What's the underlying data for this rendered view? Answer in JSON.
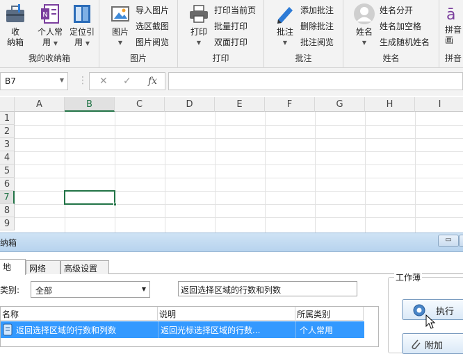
{
  "ribbon": {
    "groups": [
      {
        "label": "我的收纳箱",
        "big": [
          {
            "label1": "收",
            "label2": "纳箱"
          },
          {
            "label1": "个人常",
            "label2": "用"
          },
          {
            "label1": "定位引",
            "label2": "用"
          }
        ]
      },
      {
        "label": "图片",
        "big": [
          {
            "label1": "图片"
          }
        ],
        "small": [
          "导入图片",
          "选区截图",
          "图片阅览"
        ]
      },
      {
        "label": "打印",
        "big": [
          {
            "label1": "打印"
          }
        ],
        "small": [
          "打印当前页",
          "批量打印",
          "双面打印"
        ]
      },
      {
        "label": "批注",
        "big": [
          {
            "label1": "批注"
          }
        ],
        "small": [
          "添加批注",
          "删除批注",
          "批注阅览"
        ]
      },
      {
        "label": "姓名",
        "big": [
          {
            "label1": "姓名"
          }
        ],
        "small": [
          "姓名分开",
          "姓名加空格",
          "生成随机姓名"
        ]
      },
      {
        "label": "拼音",
        "big": [
          {
            "label1": "拼音",
            "label2": "画"
          }
        ]
      }
    ]
  },
  "formula_bar": {
    "name_box": "B7",
    "cancel_glyph": "✕",
    "enter_glyph": "✓",
    "fx_glyph": "fx",
    "formula": ""
  },
  "grid": {
    "columns": [
      "A",
      "B",
      "C",
      "D",
      "E",
      "F",
      "G",
      "H",
      "I"
    ],
    "rows": [
      "1",
      "2",
      "3",
      "4",
      "5",
      "6",
      "7",
      "8",
      "9"
    ],
    "selected_column": "B",
    "selected_row": "7"
  },
  "panel": {
    "title": "纳箱",
    "window_buttons": [
      "▭",
      "✕"
    ],
    "tabs": [
      "地",
      "网络",
      "高级设置"
    ],
    "category_label": "类别:",
    "category_value": "全部",
    "search_value": "返回选择区域的行数和列数",
    "workbook_group": "工作薄",
    "buttons": [
      "执行",
      "附加"
    ],
    "table": {
      "headers": [
        "名称",
        "说明",
        "所属类别"
      ],
      "rows": [
        {
          "name": "返回选择区域的行数和列数",
          "desc": "返回光标选择区域的行数...",
          "category": "个人常用"
        }
      ]
    }
  }
}
